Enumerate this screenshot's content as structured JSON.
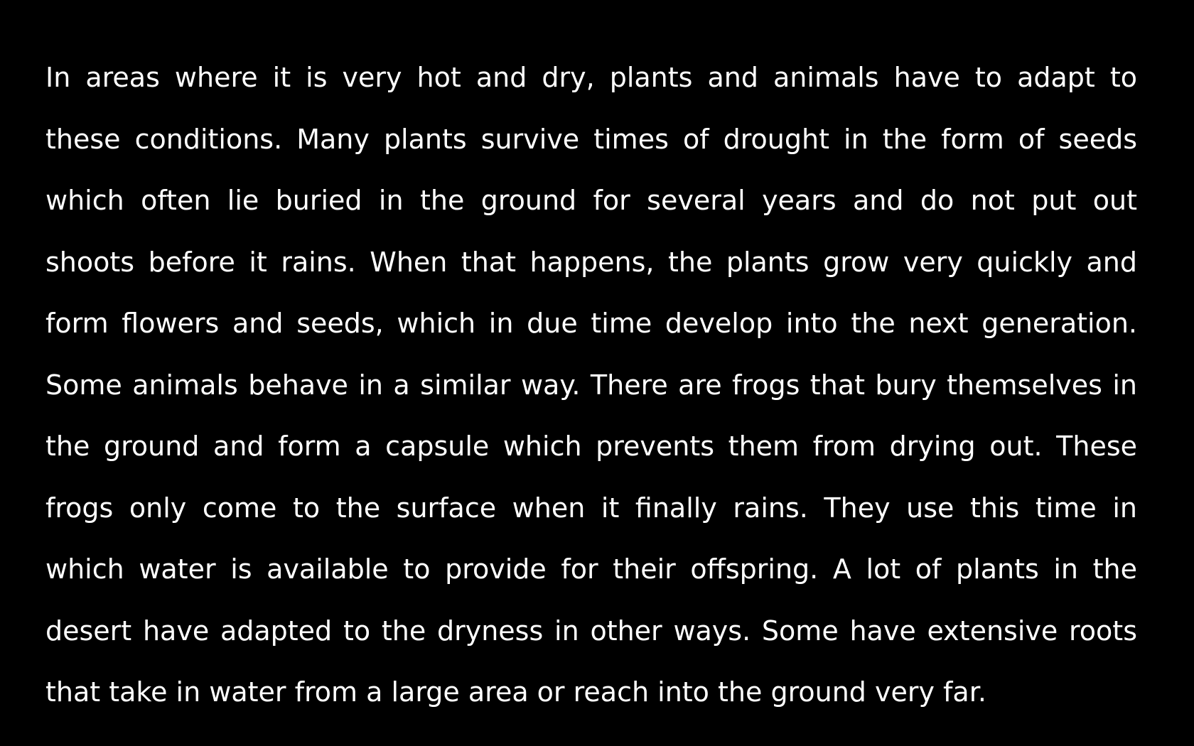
{
  "document": {
    "background_color": "#000000",
    "text_color": "#ffffff",
    "lines": [
      "In areas where it is very hot and dry, plants and animals have to adapt to",
      "these conditions. Many plants survive times of drought in the form of seeds",
      "which often lie buried in the ground for several years and do not put out",
      "shoots before it rains. When that happens, the plants grow very quickly and",
      "form flowers and seeds, which in due time develop into the next generation.",
      "Some animals behave in a similar way. There are frogs that bury themselves in",
      "the ground and form a capsule which prevents them from drying out. These",
      "frogs only come to the surface when it finally rains. They use this time in",
      "which water is available to provide for their offspring. A lot of plants in the",
      "desert have adapted to the dryness in other ways. Some have extensive roots",
      "that take in water from a large area or reach into the ground very far."
    ]
  }
}
